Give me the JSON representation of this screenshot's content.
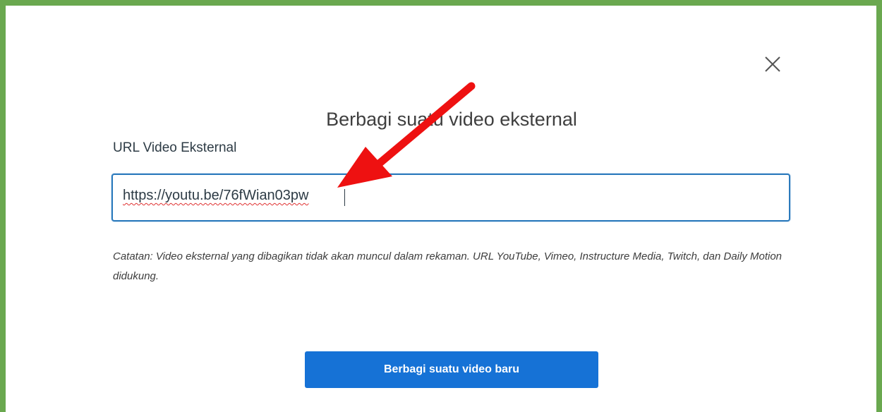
{
  "dialog": {
    "title": "Berbagi suatu video eksternal",
    "field_label": "URL Video Eksternal",
    "url_value": "https://youtu.be/76fWian03pw",
    "note": "Catatan: Video eksternal yang dibagikan tidak akan muncul dalam rekaman. URL YouTube, Vimeo, Instructure Media, Twitch, dan Daily Motion didukung.",
    "share_button_label": "Berbagi suatu video baru"
  },
  "icons": {
    "close": "close-icon",
    "annotation": "red-arrow-annotation"
  },
  "colors": {
    "frame_border": "#6aa84f",
    "primary_button": "#1672d6",
    "input_focus_border": "#2b7abc",
    "annotation_arrow": "#ee1111"
  }
}
